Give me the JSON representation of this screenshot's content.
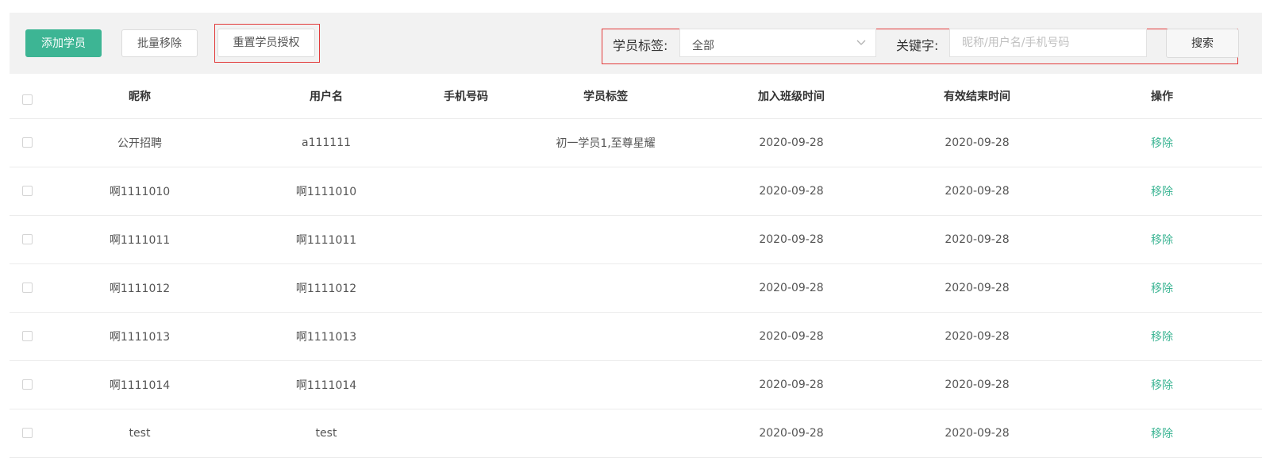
{
  "toolbar": {
    "add_label": "添加学员",
    "batch_remove_label": "批量移除",
    "reset_auth_label": "重置学员授权",
    "tag_label": "学员标签:",
    "tag_value": "全部",
    "keyword_label": "关键字:",
    "keyword_placeholder": "昵称/用户名/手机号码",
    "keyword_value": "",
    "search_label": "搜索"
  },
  "table": {
    "columns": [
      "昵称",
      "用户名",
      "手机号码",
      "学员标签",
      "加入班级时间",
      "有效结束时间",
      "操作"
    ],
    "rows": [
      {
        "nickname": "公开招聘",
        "username": "a111111",
        "phone": "",
        "tags": "初一学员1,至尊星耀",
        "joined": "2020-09-28",
        "expires": "2020-09-28",
        "action": "移除"
      },
      {
        "nickname": "啊1111010",
        "username": "啊1111010",
        "phone": "",
        "tags": "",
        "joined": "2020-09-28",
        "expires": "2020-09-28",
        "action": "移除"
      },
      {
        "nickname": "啊1111011",
        "username": "啊1111011",
        "phone": "",
        "tags": "",
        "joined": "2020-09-28",
        "expires": "2020-09-28",
        "action": "移除"
      },
      {
        "nickname": "啊1111012",
        "username": "啊1111012",
        "phone": "",
        "tags": "",
        "joined": "2020-09-28",
        "expires": "2020-09-28",
        "action": "移除"
      },
      {
        "nickname": "啊1111013",
        "username": "啊1111013",
        "phone": "",
        "tags": "",
        "joined": "2020-09-28",
        "expires": "2020-09-28",
        "action": "移除"
      },
      {
        "nickname": "啊1111014",
        "username": "啊1111014",
        "phone": "",
        "tags": "",
        "joined": "2020-09-28",
        "expires": "2020-09-28",
        "action": "移除"
      },
      {
        "nickname": "test",
        "username": "test",
        "phone": "",
        "tags": "",
        "joined": "2020-09-28",
        "expires": "2020-09-28",
        "action": "移除"
      }
    ]
  },
  "colors": {
    "primary": "#3db594",
    "highlight_frame": "#e23a3a",
    "toolbar_bg": "#f2f2f2"
  },
  "icons": {
    "select_arrow": "chevron-down-icon",
    "checkbox": "checkbox-icon"
  }
}
